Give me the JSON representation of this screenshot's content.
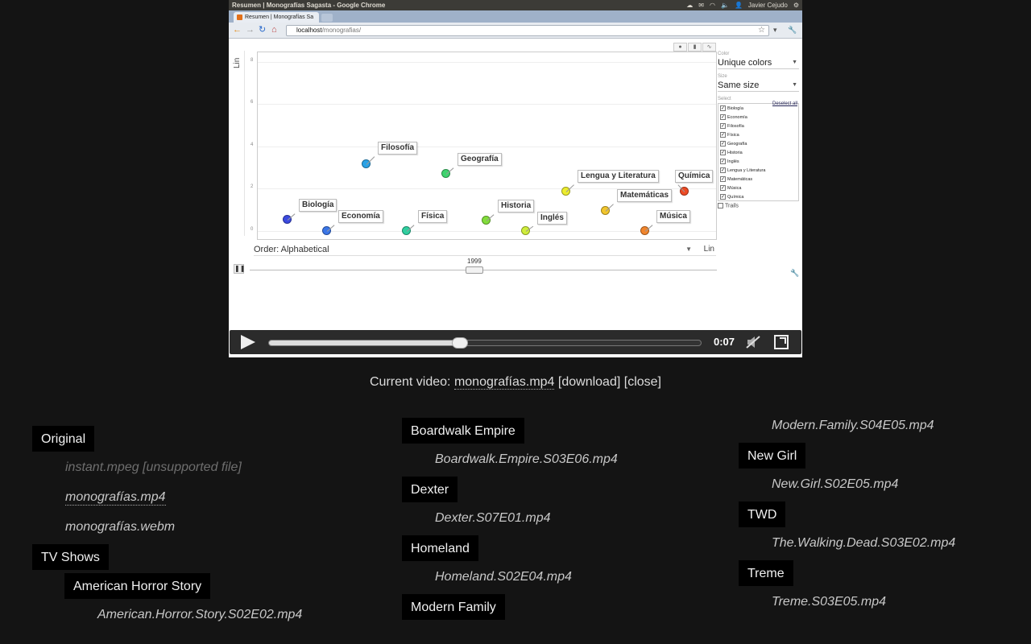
{
  "browser": {
    "window_title": "Resumen | Monografías Sagasta - Google Chrome",
    "tab_title": "Resumen | Monografías Sa",
    "user": "Javier Cejudo",
    "url_host": "localhost",
    "url_path": "/monografias/"
  },
  "chart": {
    "y_dim_label": "Lin",
    "order_label": "Order: Alphabetical",
    "x_scale": "Lin",
    "year": "1999",
    "color_caption": "Color",
    "color_value": "Unique colors",
    "size_caption": "Size",
    "size_value": "Same size",
    "select_caption": "Select",
    "deselect_all": "Deselect all",
    "trails_label": "Trails",
    "series_checklist": [
      "Biología",
      "Economía",
      "Filosofía",
      "Física",
      "Geografía",
      "Historia",
      "Inglés",
      "Lengua y Literatura",
      "Matemáticas",
      "Música",
      "Química"
    ]
  },
  "chart_data": {
    "type": "scatter",
    "ylim": [
      0,
      8
    ],
    "y_ticks": [
      "8",
      "6",
      "4",
      "2",
      "0"
    ],
    "grid": true,
    "legend_position": "right",
    "points": [
      {
        "label": "Biología",
        "y": 0.55,
        "color": "#3b4ae0"
      },
      {
        "label": "Economía",
        "y": 0.0,
        "color": "#3a76e8"
      },
      {
        "label": "Filosofía",
        "y": 3.15,
        "color": "#2aa2e6"
      },
      {
        "label": "Física",
        "y": 0.0,
        "color": "#2ed0a0"
      },
      {
        "label": "Geografía",
        "y": 2.7,
        "color": "#3ed46e"
      },
      {
        "label": "Historia",
        "y": 0.5,
        "color": "#82de3a"
      },
      {
        "label": "Inglés",
        "y": 0.0,
        "color": "#d0ee3a"
      },
      {
        "label": "Lengua y Literatura",
        "y": 1.85,
        "color": "#eded2e"
      },
      {
        "label": "Matemáticas",
        "y": 0.95,
        "color": "#f2c62c"
      },
      {
        "label": "Música",
        "y": 0.0,
        "color": "#f2852c"
      },
      {
        "label": "Química",
        "y": 1.85,
        "color": "#ee4a24"
      }
    ]
  },
  "player": {
    "time": "0:07",
    "progress": 0.44
  },
  "current": {
    "prefix": "Current video:",
    "filename": "monografías.mp4",
    "download": "[download]",
    "close": "[close]"
  },
  "listing": {
    "original_label": "Original",
    "original_files": [
      "instant.mpeg [unsupported file]",
      "monografías.mp4",
      "monografías.webm"
    ],
    "tvshows_label": "TV Shows",
    "shows": [
      {
        "name": "American Horror Story",
        "file": "American.Horror.Story.S02E02.mp4"
      },
      {
        "name": "Boardwalk Empire",
        "file": "Boardwalk.Empire.S03E06.mp4"
      },
      {
        "name": "Dexter",
        "file": "Dexter.S07E01.mp4"
      },
      {
        "name": "Homeland",
        "file": "Homeland.S02E04.mp4"
      },
      {
        "name": "Modern Family",
        "file": "Modern.Family.S04E05.mp4"
      },
      {
        "name": "New Girl",
        "file": "New.Girl.S02E05.mp4"
      },
      {
        "name": "TWD",
        "file": "The.Walking.Dead.S03E02.mp4"
      },
      {
        "name": "Treme",
        "file": "Treme.S03E05.mp4"
      }
    ]
  }
}
